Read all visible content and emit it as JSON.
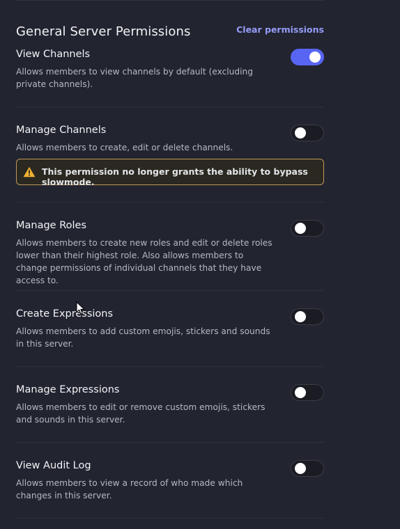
{
  "section": {
    "title": "General Server Permissions",
    "clear_label": "Clear permissions"
  },
  "permissions": [
    {
      "title": "View Channels",
      "description": "Allows members to view channels by default (excluding private channels).",
      "enabled": true
    },
    {
      "title": "Manage Channels",
      "description": "Allows members to create, edit or delete channels.",
      "enabled": false,
      "warning": "This permission no longer grants the ability to bypass slowmode."
    },
    {
      "title": "Manage Roles",
      "description": "Allows members to create new roles and edit or delete roles lower than their highest role. Also allows members to change permissions of individual channels that they have access to.",
      "enabled": false
    },
    {
      "title": "Create Expressions",
      "description": "Allows members to add custom emojis, stickers and sounds in this server.",
      "enabled": false
    },
    {
      "title": "Manage Expressions",
      "description": "Allows members to edit or remove custom emojis, stickers and sounds in this server.",
      "enabled": false
    },
    {
      "title": "View Audit Log",
      "description": "Allows members to view a record of who made which changes in this server.",
      "enabled": false
    }
  ],
  "icons": {
    "warning": "warning-triangle-icon",
    "cursor": "mouse-pointer-icon"
  },
  "colors": {
    "background": "#222430",
    "accent": "#5865f2",
    "link": "#949cf7",
    "warning_border": "#c19a5b",
    "warning_icon": "#f0b232"
  }
}
